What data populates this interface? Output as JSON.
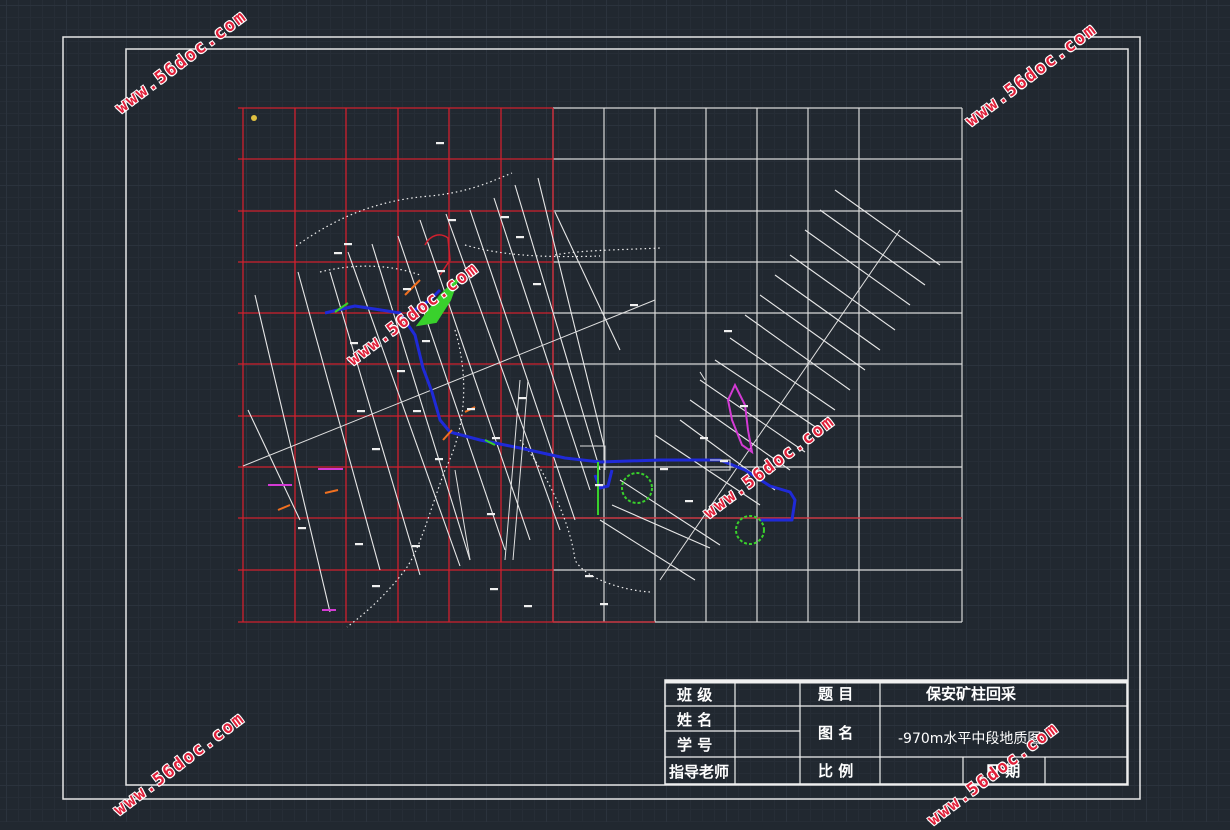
{
  "title_block": {
    "class_label": "班 级",
    "name_label": "姓 名",
    "student_id_label": "学 号",
    "advisor_label": "指导老师",
    "topic_label": "题 目",
    "topic_value": "保安矿柱回采",
    "drawing_name_label": "图 名",
    "drawing_name_value": "-970m水平中段地质图",
    "scale_label": "比 例",
    "date_label": "日 期"
  },
  "watermark": {
    "text": "www.56doc.com"
  },
  "colors": {
    "background": "#212830",
    "frame": "#e6e6e6",
    "red_grid": "#d0202e",
    "white_grid": "#d8d8d8",
    "drift_blue": "#1f2ad8",
    "green": "#39d12c",
    "magenta": "#d43ad4",
    "orange": "#f07020",
    "watermark_red": "#e0203a"
  }
}
